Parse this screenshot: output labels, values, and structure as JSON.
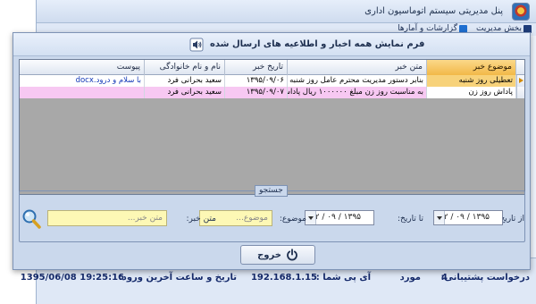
{
  "app": {
    "title": "پنل مدیریتی سیستم اتوماسیون اداری",
    "ribbon_tabs": [
      "بخش مدیریت",
      "گزارشات و آمارها"
    ]
  },
  "status_bar": {
    "support_label": "درخواست پشتیبانی:",
    "support_count": "4",
    "support_unit": "مورد",
    "ip_label": "آی پی شما :",
    "ip_value": "192.168.1.15",
    "last_login_label": "تاریخ و ساعت آخرین ورود:",
    "last_login_value": "1395/06/08 19:25:16"
  },
  "dialog": {
    "title": "فرم نمایش همه اخبار و اطلاعیه های ارسال شده",
    "header_icon": "speaker-icon"
  },
  "grid": {
    "columns": [
      "موضوع خبر",
      "متن خبر",
      "تاریخ خبر",
      "نام و نام خانوادگی",
      "پیوست"
    ],
    "rows": [
      {
        "subject": "تعطیلی روز شنبه",
        "text": "بنابر دستور مدیریت محترم عامل روز شنبه تعطیل می باشد...",
        "date": "۱۳۹۵/۰۹/۰۶",
        "name": "سعید بحرانی فرد",
        "attachment": "با سلام و درود.docx"
      },
      {
        "subject": "پاداش روز زن",
        "text": "به مناسبت روز زن مبلغ ۱۰۰۰۰۰۰ ریال پاداش به همه کارک...",
        "date": "۱۳۹۵/۰۹/۰۷",
        "name": "سعید بحرانی فرد",
        "attachment": ""
      }
    ]
  },
  "search": {
    "legend": "جستجو",
    "from_date_label": "از تاریخ:",
    "from_date_value": "۱۳۹۵ / ۰۹ / ۰۲",
    "to_date_label": "تا تاریخ:",
    "to_date_value": "۱۳۹۵ / ۰۹ / ۱۲",
    "subject_label": "موضوع:",
    "subject_placeholder": "موضوع...",
    "text_label": "متن خبر:",
    "text_placeholder": "متن خبر..."
  },
  "actions": {
    "exit_label": "خروج"
  },
  "colors": {
    "selected_header": "#f2b848",
    "highlight_row": "#f7c8f2",
    "input_background": "#fdf8b5"
  }
}
